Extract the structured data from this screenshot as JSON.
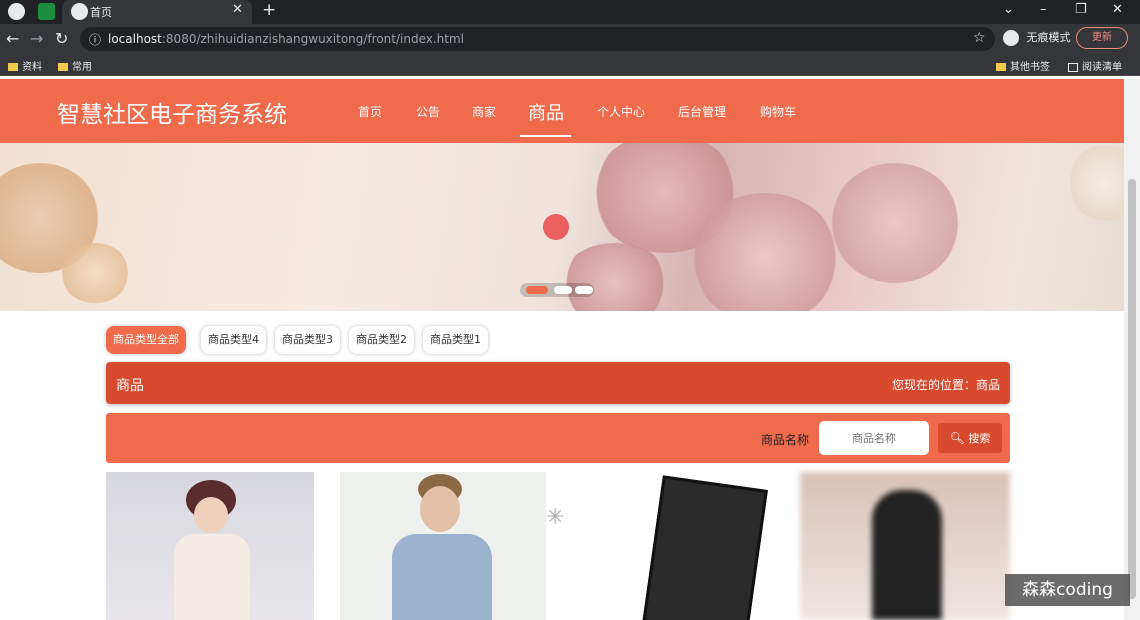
{
  "browser": {
    "tab_title": "首页",
    "url_host": "localhost",
    "url_path": ":8080/zhihuidianzishangwuxitong/front/index.html",
    "incognito_label": "无痕模式",
    "update_label": "更新",
    "bookmarks": [
      "资料",
      "常用"
    ],
    "bookmarks_right": [
      "其他书签",
      "阅读清单"
    ]
  },
  "site": {
    "title": "智慧社区电子商务系统",
    "nav": [
      "首页",
      "公告",
      "商家",
      "商品",
      "个人中心",
      "后台管理",
      "购物车"
    ],
    "active_nav": "商品"
  },
  "categories": [
    "商品类型全部",
    "商品类型4",
    "商品类型3",
    "商品类型2",
    "商品类型1"
  ],
  "section": {
    "title": "商品",
    "location": "您现在的位置：商品"
  },
  "search": {
    "label": "商品名称",
    "placeholder": "商品名称",
    "button": "搜索"
  },
  "watermark": "森森coding",
  "colors": {
    "primary": "#ef6b4c",
    "dark": "#d74a2e"
  }
}
